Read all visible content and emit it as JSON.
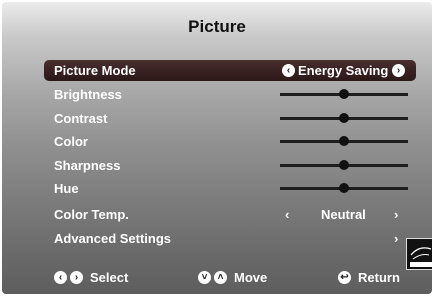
{
  "title": "Picture",
  "menu": {
    "picture_mode": {
      "label": "Picture Mode",
      "value": "Energy Saving"
    },
    "brightness": {
      "label": "Brightness",
      "level": 0.5
    },
    "contrast": {
      "label": "Contrast",
      "level": 0.5
    },
    "color": {
      "label": "Color",
      "level": 0.5
    },
    "sharpness": {
      "label": "Sharpness",
      "level": 0.5
    },
    "hue": {
      "label": "Hue",
      "level": 0.5
    },
    "color_temp": {
      "label": "Color Temp.",
      "value": "Neutral"
    },
    "advanced": {
      "label": "Advanced Settings"
    }
  },
  "footer": {
    "select": "Select",
    "move": "Move",
    "return": "Return"
  },
  "icons": {
    "left": "‹",
    "right": "›",
    "down": "˅",
    "up": "˄",
    "return": "↩"
  }
}
